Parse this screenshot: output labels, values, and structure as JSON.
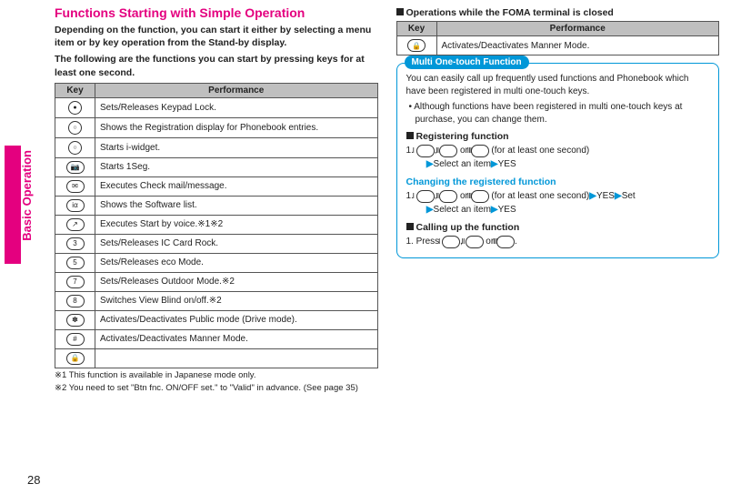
{
  "sideTab": "Basic Operation",
  "pageNumber": "28",
  "left": {
    "title": "Functions Starting with Simple Operation",
    "intro1": "Depending on the function, you can start it either by selecting a menu item or by key operation from the Stand-by display.",
    "intro2": "The following are the functions you can start by pressing keys for at least one second.",
    "th_key": "Key",
    "th_perf": "Performance",
    "rows": [
      {
        "key": "●",
        "perf": "Sets/Releases Keypad Lock."
      },
      {
        "key": "○",
        "perf": "Shows the Registration display for Phonebook entries."
      },
      {
        "key": "○",
        "perf": "Starts i-widget."
      },
      {
        "key": "📷",
        "perf": "Starts 1Seg."
      },
      {
        "key": "✉",
        "perf": "Executes Check mail/message."
      },
      {
        "key": "iα",
        "perf": "Shows the Software list."
      },
      {
        "key": "↗",
        "perf": "Executes Start by voice.※1※2"
      },
      {
        "key": "3",
        "perf": "Sets/Releases IC Card Rock."
      },
      {
        "key": "5",
        "perf": "Sets/Releases eco Mode."
      },
      {
        "key": "7",
        "perf": "Sets/Releases Outdoor Mode.※2"
      },
      {
        "key": "8",
        "perf": "Switches View Blind on/off.※2"
      },
      {
        "key": "✽",
        "perf": "Activates/Deactivates Public mode (Drive mode)."
      },
      {
        "key": "#",
        "perf": "Activates/Deactivates Manner Mode."
      },
      {
        "key": "🔒",
        "perf": ""
      }
    ],
    "note1": "※1  This function is available in Japanese mode only.",
    "note2": "※2  You need to set \"Btn fnc. ON/OFF set.\" to \"Valid\" in advance. (See page 35)"
  },
  "right": {
    "closedHead": "Operations while the FOMA terminal is closed",
    "th_key": "Key",
    "th_perf": "Performance",
    "row": {
      "key": "🔒",
      "perf": "Activates/Deactivates Manner Mode."
    },
    "boxTitle": "Multi One-touch Function",
    "boxP1": "You can easily call up frequently used functions and Phonebook which have been registered in multi one-touch keys.",
    "boxBullet": "Although functions have been registered in multi one-touch keys at purchase, you can change them.",
    "regHead": "Registering function",
    "keyI": "Ⅰ",
    "keyII": "Ⅱ",
    "keyIII": "Ⅲ",
    "regLine1a": "1.",
    "regLine1b": ", ",
    "regLine1c": " or ",
    "regLine1d": " (for at least one second)",
    "regLine2": "Select an item",
    "yes": "YES",
    "chgHead": "Changing the registered function",
    "set": "Set",
    "callHead": "Calling up the function",
    "press": "1. Press ",
    "comma": ", ",
    "or": " or ",
    "period": "."
  }
}
